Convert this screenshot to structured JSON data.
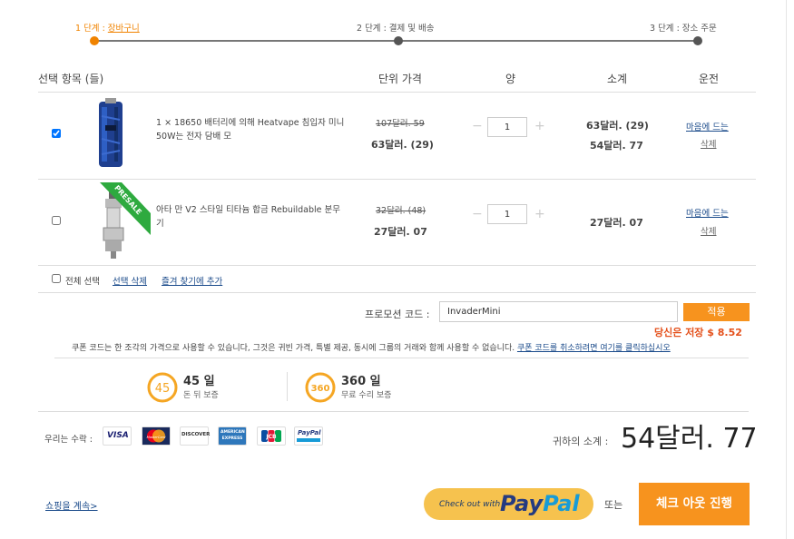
{
  "progress": {
    "step1_prefix": "1 단계 : ",
    "step1_link": "장바구니",
    "step2": "2 단계 : 결제 및 배송",
    "step3": "3 단계 : 장소 주문"
  },
  "table_headers": {
    "items": "선택 항목 (들)",
    "unit_price": "단위 가격",
    "qty": "양",
    "subtotal": "소계",
    "action": "운전"
  },
  "cart_items": [
    {
      "checked": true,
      "name": "1 × 18650 배터리에 의해 Heatvape 침입자 미니 50W는 전자 담배 모",
      "old_price": "107달러. 59",
      "new_price": "63달러. (29)",
      "qty": "1",
      "subtotal_line1": "63달러. (29)",
      "subtotal_line2": "54달러. 77",
      "wishlist_label": "마음에 드는",
      "delete_label": "삭제",
      "image_icon": "battery-mod-icon"
    },
    {
      "checked": false,
      "name": "아타 만 V2 스타일 티타늄 합금 Rebuildable 분무기",
      "old_price": "32달러. (48)",
      "new_price": "27달러. 07",
      "qty": "1",
      "subtotal_line1": "27달러. 07",
      "wishlist_label": "마음에 드는",
      "delete_label": "삭제",
      "badge": "PRESALE",
      "image_icon": "atomizer-icon"
    }
  ],
  "qty_controls": {
    "minus": "−",
    "plus": "+"
  },
  "bulk_actions": {
    "select_all": "전체 선택",
    "delete_selected": "선택 삭제",
    "add_favorites": "즐겨 찾기에 추가"
  },
  "promo": {
    "label": "프로모션 코드 :",
    "value": "InvaderMini",
    "apply_label": "적용",
    "saving_text": "당신은 저장 $ 8.52",
    "note": "쿠폰 코드는 한 조각의 가격으로 사용할 수 있습니다, 그것은 귀빈 가격, 특별 제공, 동시에 그룹의 거래와 함께 사용할 수 없습니다. ",
    "cancel_link": "쿠폰 코드를 취소하려면 여기를 클릭하십시오"
  },
  "guarantees": [
    {
      "icon_text": "45",
      "title": "45 일",
      "subtitle": "돈 뒤 보증"
    },
    {
      "icon_text": "360",
      "title": "360 일",
      "subtitle": "무료 수리 보증"
    }
  ],
  "payment": {
    "accept_label": "우리는 수락 :",
    "cards": [
      "VISA",
      "MasterCard",
      "DISCOVER",
      "AMERICAN EXPRESS",
      "JCB",
      "PayPal"
    ]
  },
  "totals": {
    "subtotal_label": "귀하의 소계 :",
    "subtotal_value": "54달러. 77"
  },
  "footer": {
    "continue_shopping": "쇼핑을 계속>",
    "paypal_prefix": "Check out with",
    "paypal_word1": "Pay",
    "paypal_word2": "Pal",
    "or_text": "또는",
    "checkout_label": "체크 아웃 진행"
  },
  "colors": {
    "accent": "#f7931e",
    "saving": "#e4501b",
    "link": "#1a4a8a",
    "guarantee_ring": "#f5a623"
  }
}
